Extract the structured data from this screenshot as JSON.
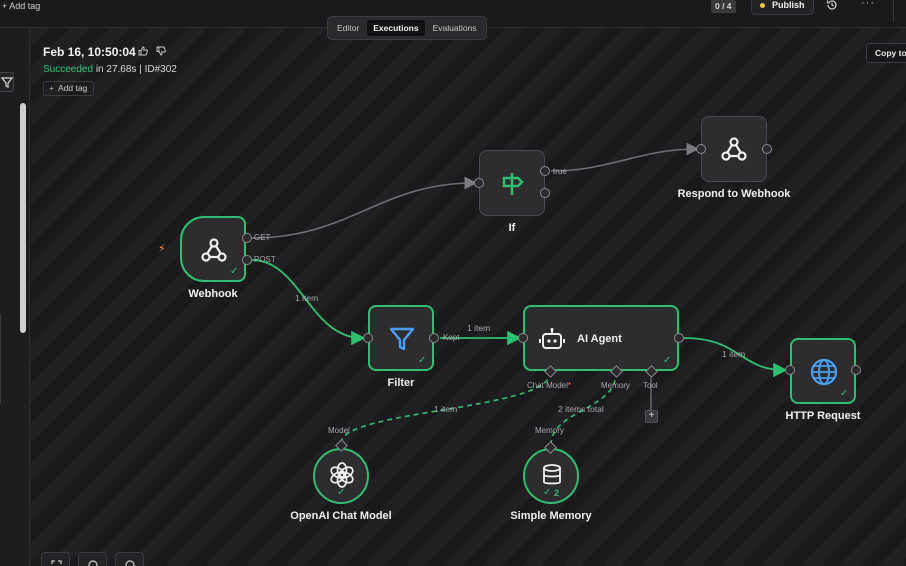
{
  "topbar": {
    "add_tag": "+ Add tag",
    "counter": "0 / 4",
    "publish": "Publish",
    "more": "···"
  },
  "tabs": [
    "Editor",
    "Executions",
    "Evaluations"
  ],
  "execution": {
    "date": "Feb 16, 10:50:04",
    "status": "Succeeded",
    "duration": "in 27.68s | ID#302",
    "add_tag": "Add tag",
    "copy_button": "Copy to"
  },
  "nodes": {
    "webhook": {
      "label": "Webhook",
      "outputs": [
        "GET",
        "POST"
      ]
    },
    "if": {
      "label": "If",
      "outputs": [
        "true"
      ]
    },
    "respond": {
      "label": "Respond to Webhook"
    },
    "filter": {
      "label": "Filter",
      "output": "Kept"
    },
    "agent": {
      "label": "AI Agent",
      "subports": [
        "Chat Model",
        "Memory",
        "Tool"
      ],
      "required_mark": "*"
    },
    "http": {
      "label": "HTTP Request"
    },
    "openai": {
      "label": "OpenAI Chat Model",
      "port": "Model"
    },
    "memory": {
      "label": "Simple Memory",
      "port": "Memory",
      "count": "2"
    }
  },
  "wire_labels": {
    "post_filter": "1 item",
    "filter_agent": "1 item",
    "agent_http": "1 item",
    "model_agent": "1 item",
    "memory_agent": "2 items total"
  },
  "colors": {
    "success": "#2fbf71",
    "trigger_bolt": "#ff8a34",
    "publish_dot": "#f2c744",
    "filter_icon": "#4a9ff5",
    "if_icon": "#2fbf71",
    "http_icon": "#4a9ff5"
  }
}
